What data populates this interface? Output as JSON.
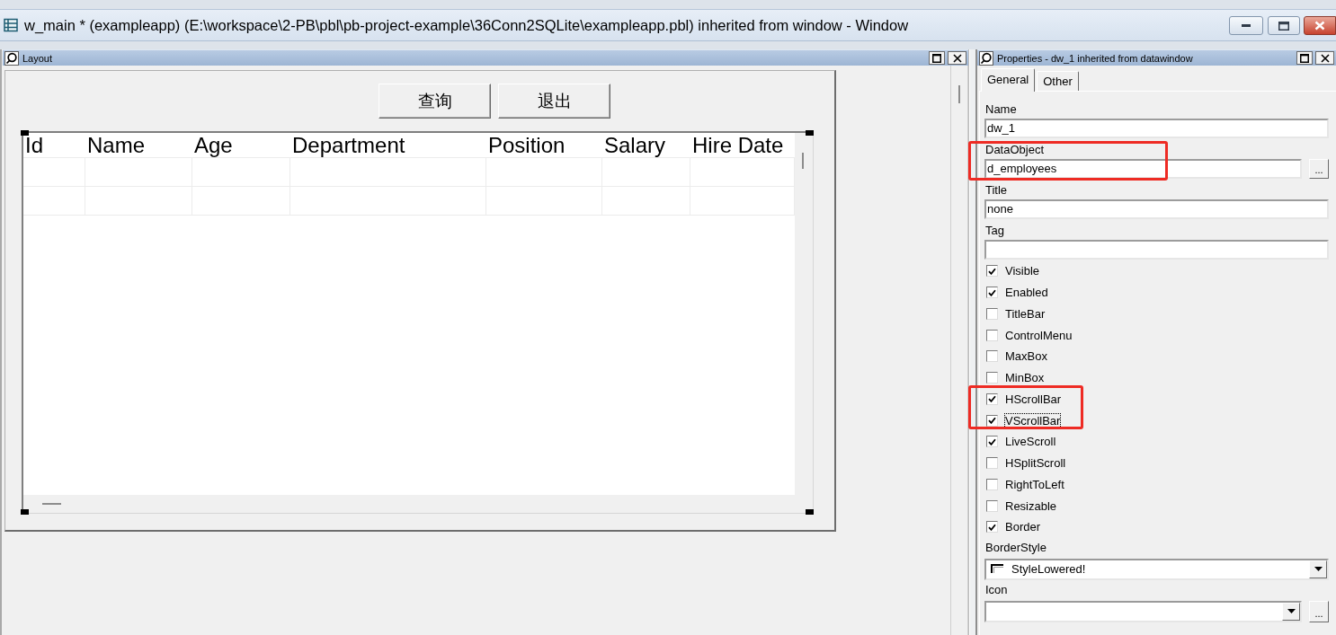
{
  "window": {
    "title": "w_main * (exampleapp) (E:\\workspace\\2-PB\\pbl\\pb-project-example\\36Conn2SQLite\\exampleapp.pbl) inherited from window - Window"
  },
  "layout_panel": {
    "title": "Layout",
    "buttons": [
      "查询",
      "退出"
    ],
    "datawindow": {
      "columns": [
        "Id",
        "Name",
        "Age",
        "Department",
        "Position",
        "Salary",
        "Hire Date"
      ]
    }
  },
  "properties_panel": {
    "title": "Properties - dw_1 inherited from datawindow",
    "tabs": [
      {
        "label": "General",
        "selected": true
      },
      {
        "label": "Other",
        "selected": false
      }
    ],
    "items": [
      {
        "kind": "text",
        "label": "Name",
        "value": "dw_1",
        "highlighted": false
      },
      {
        "kind": "text",
        "label": "DataObject",
        "value": "d_employees",
        "browse_button": "...",
        "highlighted": true
      },
      {
        "kind": "text",
        "label": "Title",
        "value": "none",
        "highlighted": false
      },
      {
        "kind": "text",
        "label": "Tag",
        "highlighted": false
      },
      {
        "kind": "checkbox",
        "label": "Visible",
        "checked": true,
        "focused": false,
        "highlighted": false
      },
      {
        "kind": "checkbox",
        "label": "Enabled",
        "checked": true,
        "focused": false,
        "highlighted": false
      },
      {
        "kind": "checkbox",
        "label": "TitleBar",
        "checked": false,
        "focused": false,
        "highlighted": false
      },
      {
        "kind": "checkbox",
        "label": "ControlMenu",
        "checked": false,
        "focused": false,
        "highlighted": false
      },
      {
        "kind": "checkbox",
        "label": "MaxBox",
        "checked": false,
        "focused": false,
        "highlighted": false
      },
      {
        "kind": "checkbox",
        "label": "MinBox",
        "checked": false,
        "focused": false,
        "highlighted": false
      },
      {
        "kind": "checkbox",
        "label": "HScrollBar",
        "checked": true,
        "focused": false,
        "highlighted": true
      },
      {
        "kind": "checkbox",
        "label": "VScrollBar",
        "checked": true,
        "focused": true,
        "highlighted": true
      },
      {
        "kind": "checkbox",
        "label": "LiveScroll",
        "checked": true,
        "focused": false,
        "highlighted": false
      },
      {
        "kind": "checkbox",
        "label": "HSplitScroll",
        "checked": false,
        "focused": false,
        "highlighted": false
      },
      {
        "kind": "checkbox",
        "label": "RightToLeft",
        "checked": false,
        "focused": false,
        "highlighted": false
      },
      {
        "kind": "checkbox",
        "label": "Resizable",
        "checked": false,
        "focused": false,
        "highlighted": false
      },
      {
        "kind": "checkbox",
        "label": "Border",
        "checked": true,
        "focused": false,
        "highlighted": false
      },
      {
        "kind": "dropdown",
        "label": "BorderStyle",
        "value": "StyleLowered!",
        "highlighted": false
      },
      {
        "kind": "dropdown",
        "label": "Icon",
        "browse_button": "...",
        "highlighted": false
      }
    ]
  }
}
